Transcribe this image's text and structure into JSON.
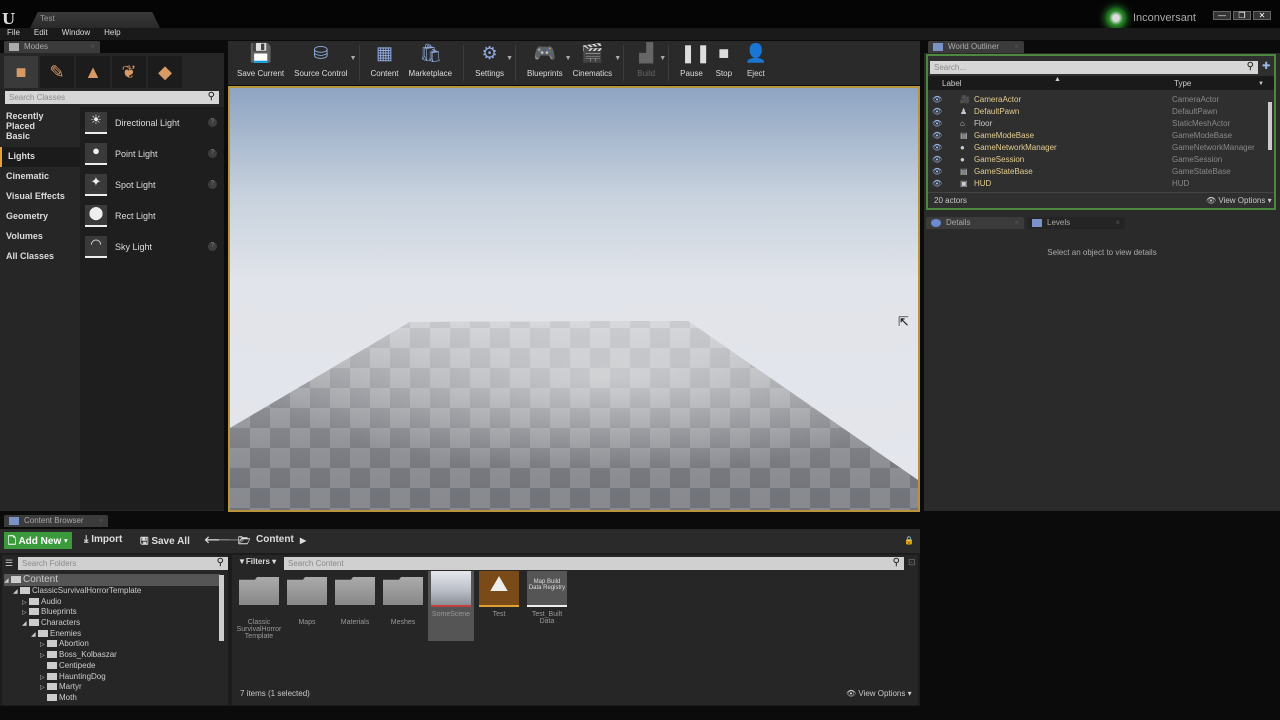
{
  "window": {
    "tab_title": "Test",
    "user": "Inconversant",
    "controls": [
      "—",
      "❐",
      "✕"
    ]
  },
  "menu": [
    "File",
    "Edit",
    "Window",
    "Help"
  ],
  "modes": {
    "tab": "Modes",
    "search_placeholder": "Search Classes",
    "categories": [
      "Recently Placed",
      "Basic",
      "Lights",
      "Cinematic",
      "Visual Effects",
      "Geometry",
      "Volumes",
      "All Classes"
    ],
    "selected_category": "Lights",
    "items": [
      {
        "label": "Directional Light",
        "help": true
      },
      {
        "label": "Point Light",
        "help": true
      },
      {
        "label": "Spot Light",
        "help": true
      },
      {
        "label": "Rect Light",
        "help": false
      },
      {
        "label": "Sky Light",
        "help": true
      }
    ]
  },
  "toolbar": [
    {
      "label": "Save Current",
      "icon": "save-icon"
    },
    {
      "label": "Source Control",
      "icon": "source-control-icon",
      "dropdown": true
    },
    {
      "label": "Content",
      "icon": "content-icon"
    },
    {
      "label": "Marketplace",
      "icon": "marketplace-icon"
    },
    {
      "label": "Settings",
      "icon": "settings-icon",
      "dropdown": true
    },
    {
      "label": "Blueprints",
      "icon": "blueprints-icon",
      "dropdown": true
    },
    {
      "label": "Cinematics",
      "icon": "cinematics-icon",
      "dropdown": true
    },
    {
      "label": "Build",
      "icon": "build-icon",
      "dropdown": true,
      "disabled": true
    },
    {
      "label": "Pause",
      "icon": "pause-icon"
    },
    {
      "label": "Stop",
      "icon": "stop-icon"
    },
    {
      "label": "Eject",
      "icon": "eject-icon"
    }
  ],
  "outliner": {
    "tab": "World Outliner",
    "search_placeholder": "Search...",
    "col_label": "Label",
    "col_type": "Type",
    "rows": [
      {
        "label": "CameraActor",
        "type": "CameraActor"
      },
      {
        "label": "DefaultPawn",
        "type": "DefaultPawn"
      },
      {
        "label": "Floor",
        "type": "StaticMeshActor"
      },
      {
        "label": "GameModeBase",
        "type": "GameModeBase"
      },
      {
        "label": "GameNetworkManager",
        "type": "GameNetworkManager"
      },
      {
        "label": "GameSession",
        "type": "GameSession"
      },
      {
        "label": "GameStateBase",
        "type": "GameStateBase"
      },
      {
        "label": "HUD",
        "type": "HUD"
      }
    ],
    "count": "20 actors",
    "view_options": "View Options"
  },
  "details": {
    "tab": "Details",
    "levels_tab": "Levels",
    "empty": "Select an object to view details"
  },
  "content_browser": {
    "tab": "Content Browser",
    "add_new": "Add New",
    "import": "Import",
    "save_all": "Save All",
    "path": "Content",
    "folder_search": "Search Folders",
    "filters": "Filters",
    "content_search": "Search Content",
    "tree": [
      {
        "label": "Content",
        "depth": 0,
        "exp": "◢",
        "sel": true
      },
      {
        "label": "ClassicSurvivalHorrorTemplate",
        "depth": 1,
        "exp": "◢"
      },
      {
        "label": "Audio",
        "depth": 2,
        "exp": "▷"
      },
      {
        "label": "Blueprints",
        "depth": 2,
        "exp": "▷"
      },
      {
        "label": "Characters",
        "depth": 2,
        "exp": "◢"
      },
      {
        "label": "Enemies",
        "depth": 3,
        "exp": "◢"
      },
      {
        "label": "Abortion",
        "depth": 4,
        "exp": "▷"
      },
      {
        "label": "Boss_Kolbaszar",
        "depth": 4,
        "exp": "▷"
      },
      {
        "label": "Centipede",
        "depth": 4,
        "exp": ""
      },
      {
        "label": "HauntingDog",
        "depth": 4,
        "exp": "▷"
      },
      {
        "label": "Martyr",
        "depth": 4,
        "exp": "▷"
      },
      {
        "label": "Moth",
        "depth": 4,
        "exp": ""
      }
    ],
    "assets": [
      {
        "label": "Classic SurvivalHorror Template",
        "kind": "folder"
      },
      {
        "label": "Maps",
        "kind": "folder"
      },
      {
        "label": "Materials",
        "kind": "folder"
      },
      {
        "label": "Meshes",
        "kind": "folder"
      },
      {
        "label": "SomeScene",
        "kind": "scene",
        "selected": true
      },
      {
        "label": "Test",
        "kind": "map"
      },
      {
        "label": "Test_Built Data",
        "kind": "registry",
        "thumb_text": "Map Build Data Registry"
      }
    ],
    "status": "7 items (1 selected)",
    "view_options": "View Options"
  }
}
